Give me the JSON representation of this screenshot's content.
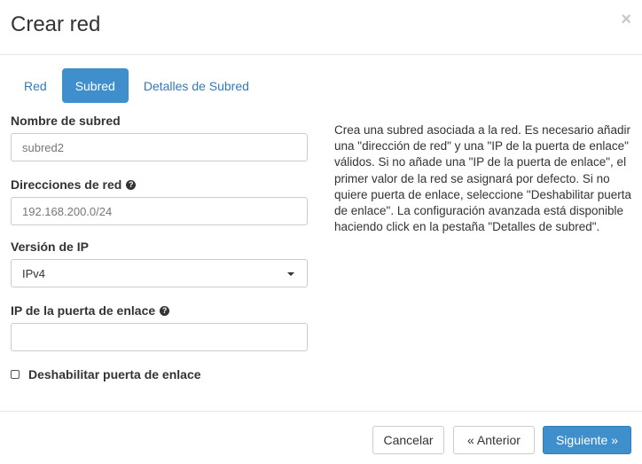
{
  "dialog": {
    "title": "Crear red",
    "close_glyph": "×"
  },
  "tabs": [
    {
      "label": "Red",
      "active": false
    },
    {
      "label": "Subred",
      "active": true
    },
    {
      "label": "Detalles de Subred",
      "active": false
    }
  ],
  "form": {
    "subnet_name": {
      "label": "Nombre de subred",
      "value": "subred2"
    },
    "network_address": {
      "label": "Direcciones de red",
      "value": "192.168.200.0/24"
    },
    "ip_version": {
      "label": "Versión de IP",
      "selected": "IPv4"
    },
    "gateway_ip": {
      "label": "IP de la puerta de enlace",
      "value": ""
    },
    "disable_gateway": {
      "label": "Deshabilitar puerta de enlace",
      "checked": false
    }
  },
  "help": {
    "text": "Crea una subred asociada a la red. Es necesario añadir una \"dirección de red\" y una \"IP de la puerta de enlace\" válidos. Si no añade una \"IP de la puerta de enlace\", el primer valor de la red se asignará por defecto. Si no quiere puerta de enlace, seleccione \"Deshabilitar puerta de enlace\". La configuración avanzada está disponible haciendo click en la pestaña \"Detalles de subred\"."
  },
  "footer": {
    "cancel_label": "Cancelar",
    "previous_label": "« Anterior",
    "next_label": "Siguiente »"
  },
  "colors": {
    "primary": "#3f8fcd",
    "link": "#337ab7"
  }
}
